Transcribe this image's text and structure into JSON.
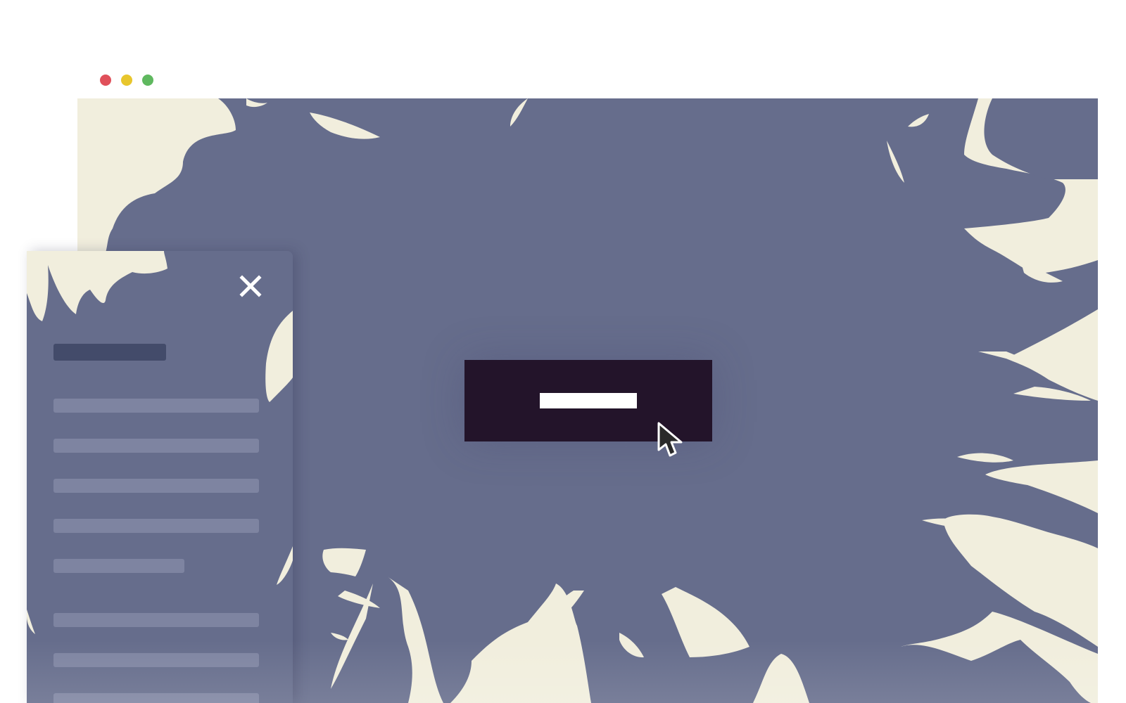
{
  "window": {
    "title": "",
    "controls": [
      {
        "name": "close-dot",
        "color": "#e0505a"
      },
      {
        "name": "minimize-dot",
        "color": "#e8c62d"
      },
      {
        "name": "maximize-dot",
        "color": "#5fb85f"
      }
    ]
  },
  "colors": {
    "background_cream": "#f1eedd",
    "splat_slate": "#666d8c",
    "drawer_bg": "#666d8c",
    "drawer_title_bar": "#434b6a",
    "drawer_item_bar": "#7e84a1",
    "cta_bg": "#23142a",
    "cta_text": "#ffffff"
  },
  "hero": {
    "cta_label": ""
  },
  "drawer": {
    "title": "",
    "close_icon": "close-icon",
    "items": [
      "",
      "",
      "",
      "",
      "",
      "",
      "",
      ""
    ]
  },
  "cursor": {
    "icon": "arrow-cursor-icon"
  }
}
